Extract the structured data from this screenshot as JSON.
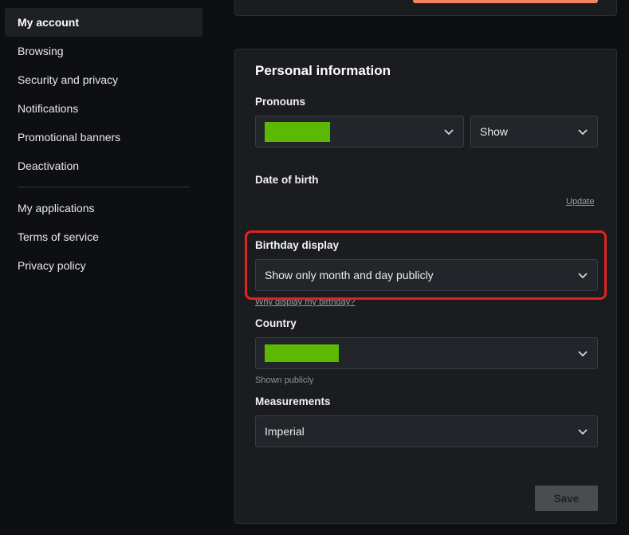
{
  "sidebar": {
    "items": [
      {
        "label": "My account",
        "active": true
      },
      {
        "label": "Browsing"
      },
      {
        "label": "Security and privacy"
      },
      {
        "label": "Notifications"
      },
      {
        "label": "Promotional banners"
      },
      {
        "label": "Deactivation"
      },
      {
        "label": "My applications"
      },
      {
        "label": "Terms of service"
      },
      {
        "label": "Privacy policy"
      }
    ]
  },
  "personal_info": {
    "title": "Personal information",
    "pronouns": {
      "label": "Pronouns",
      "value_redacted": true,
      "visibility": "Show"
    },
    "date_of_birth": {
      "label": "Date of birth",
      "update_link": "Update"
    },
    "birthday_display": {
      "label": "Birthday display",
      "value": "Show only month and day publicly",
      "help_link": "Why display my birthday?"
    },
    "country": {
      "label": "Country",
      "value_redacted": true,
      "helper": "Shown publicly"
    },
    "measurements": {
      "label": "Measurements",
      "value": "Imperial"
    },
    "save_label": "Save"
  },
  "colors": {
    "accent_orange": "#f4845f",
    "redaction_green": "#5cb800",
    "highlight_red": "#e0231c"
  }
}
